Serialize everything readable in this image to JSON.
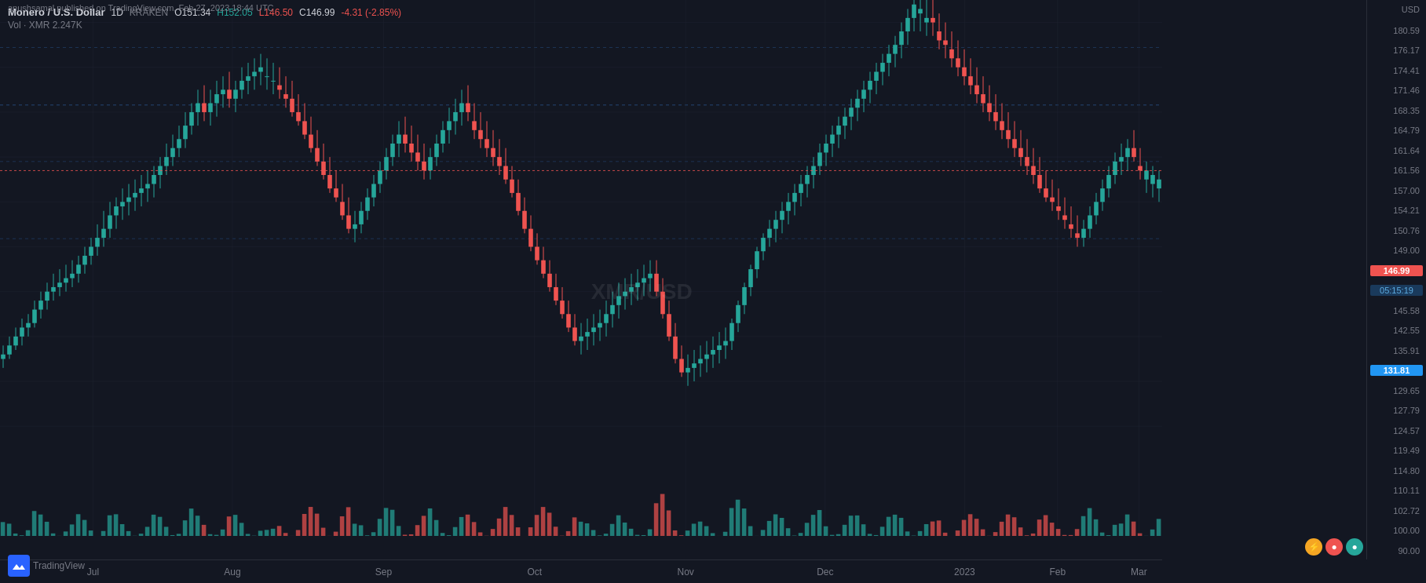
{
  "header": {
    "symbol": "Monero / U.S. Dollar",
    "timeframe": "1D",
    "exchange": "KRAKEN",
    "open_label": "O",
    "open_value": "151.34",
    "high_label": "H",
    "high_value": "152.05",
    "low_label": "L",
    "low_value": "146.50",
    "close_label": "C",
    "close_value": "146.99",
    "change_value": "-4.31 (-2.85%)",
    "volume_label": "Vol · XMR",
    "volume_value": "2.247K"
  },
  "price_levels": [
    {
      "value": "180.59",
      "type": "normal"
    },
    {
      "value": "176.17",
      "type": "normal"
    },
    {
      "value": "174.41",
      "type": "normal"
    },
    {
      "value": "171.46",
      "type": "normal"
    },
    {
      "value": "168.35",
      "type": "normal"
    },
    {
      "value": "164.79",
      "type": "normal"
    },
    {
      "value": "161.64",
      "type": "normal"
    },
    {
      "value": "161.56",
      "type": "normal"
    },
    {
      "value": "157.00",
      "type": "normal"
    },
    {
      "value": "154.21",
      "type": "normal"
    },
    {
      "value": "150.76",
      "type": "normal"
    },
    {
      "value": "149.00",
      "type": "normal"
    },
    {
      "value": "146.99",
      "type": "highlight-red"
    },
    {
      "value": "05:15:19",
      "type": "highlight-blue"
    },
    {
      "value": "145.58",
      "type": "normal"
    },
    {
      "value": "142.55",
      "type": "normal"
    },
    {
      "value": "135.91",
      "type": "normal"
    },
    {
      "value": "131.81",
      "type": "highlight-current"
    },
    {
      "value": "129.65",
      "type": "normal"
    },
    {
      "value": "127.79",
      "type": "normal"
    },
    {
      "value": "124.57",
      "type": "normal"
    },
    {
      "value": "119.49",
      "type": "normal"
    },
    {
      "value": "114.80",
      "type": "normal"
    },
    {
      "value": "110.11",
      "type": "normal"
    },
    {
      "value": "102.72",
      "type": "normal"
    },
    {
      "value": "100.00",
      "type": "normal"
    },
    {
      "value": "90.00",
      "type": "normal"
    }
  ],
  "time_labels": [
    {
      "label": "Jul",
      "pct": 8
    },
    {
      "label": "Aug",
      "pct": 20
    },
    {
      "label": "Sep",
      "pct": 33
    },
    {
      "label": "Oct",
      "pct": 46
    },
    {
      "label": "Nov",
      "pct": 59
    },
    {
      "label": "Dec",
      "pct": 71
    },
    {
      "label": "2023",
      "pct": 83
    },
    {
      "label": "Feb",
      "pct": 91
    },
    {
      "label": "Mar",
      "pct": 98
    }
  ],
  "watermark": "XMR/USD",
  "published_by": "anushsamal published on TradingView.com, Feb 27, 2023 18:44 UTC",
  "usd_label": "USD",
  "tradingview_label": "TradingView"
}
